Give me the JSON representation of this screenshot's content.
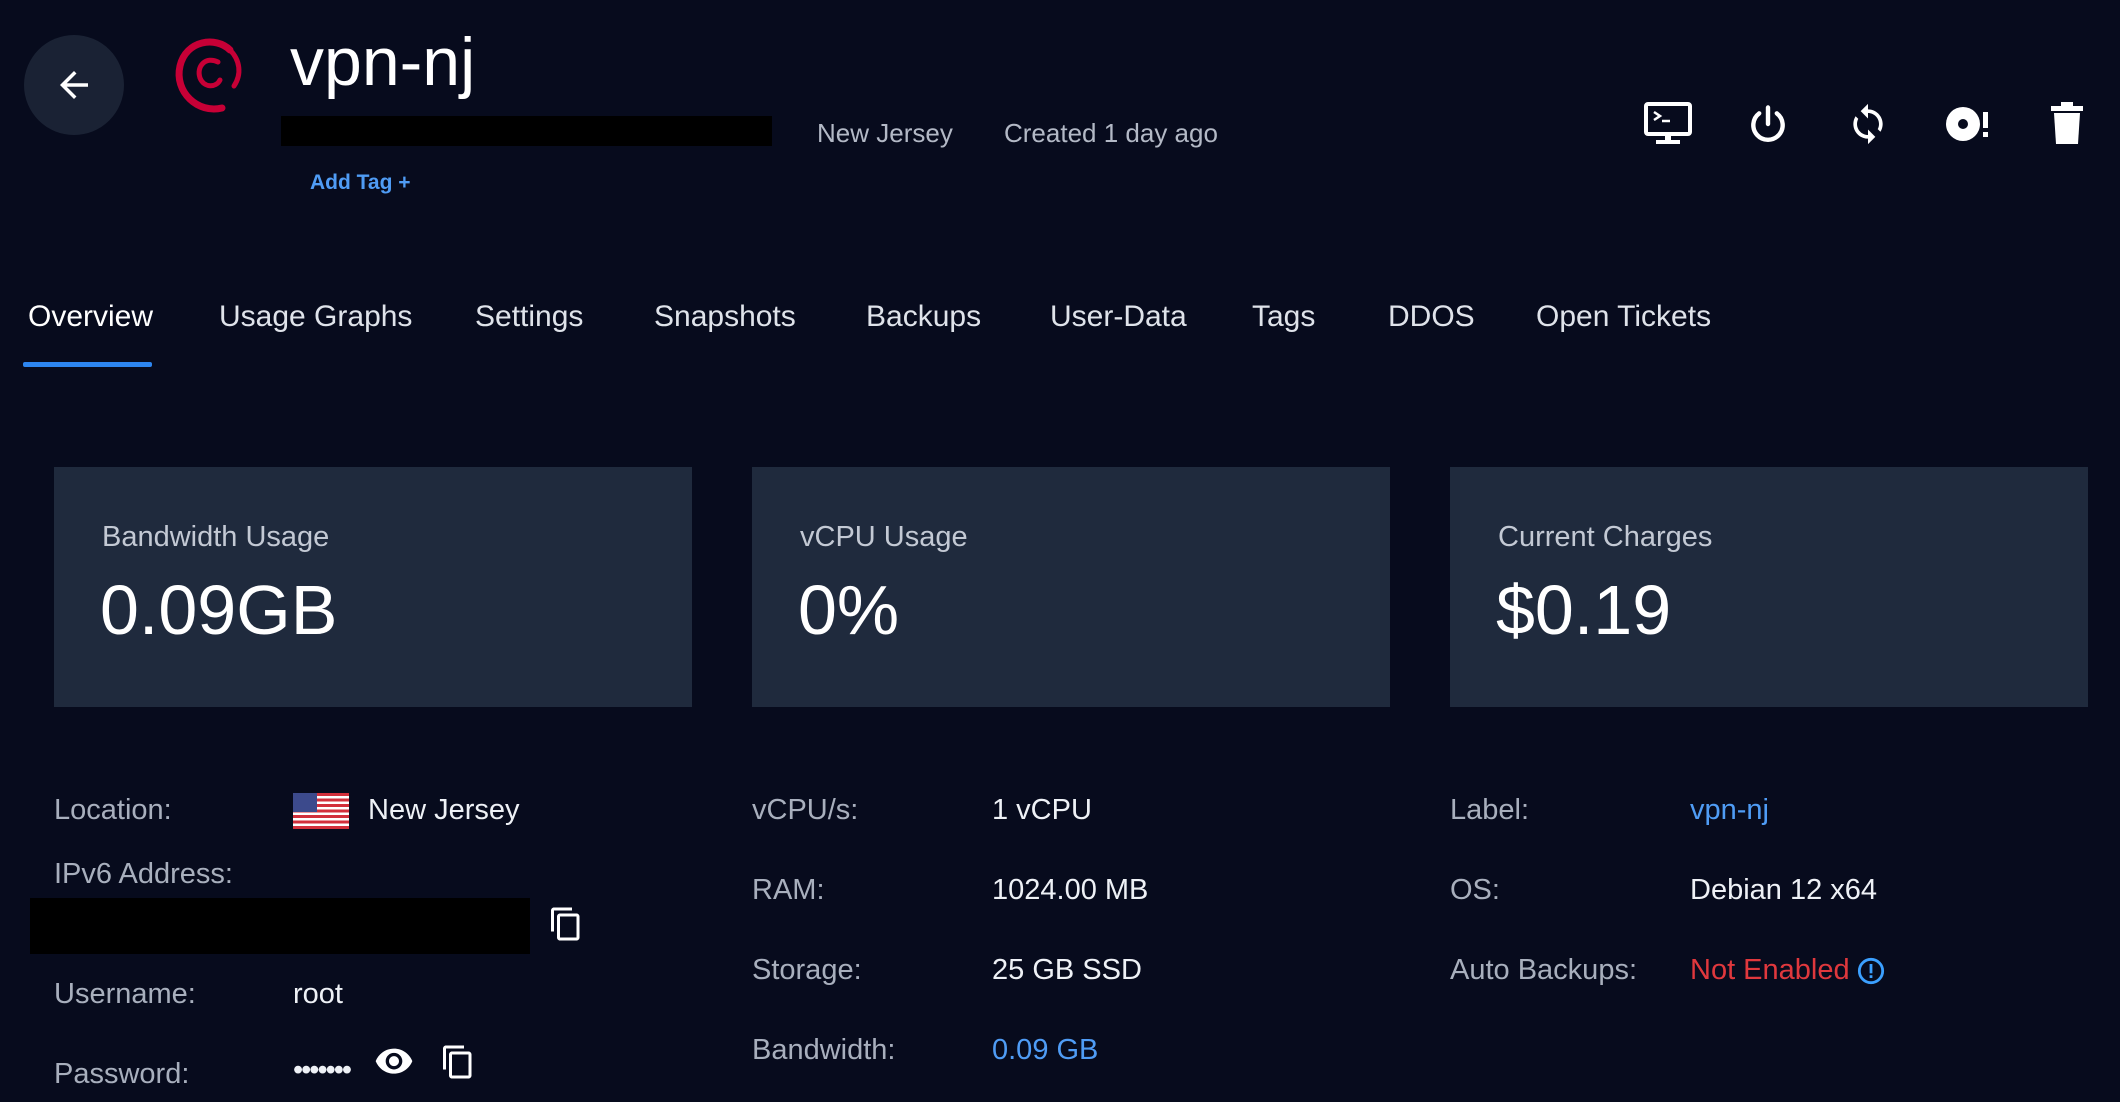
{
  "header": {
    "title": "vpn-nj",
    "location": "New Jersey",
    "created": "Created 1 day ago",
    "add_tag": "Add Tag +"
  },
  "actions": [
    "console-icon",
    "power-icon",
    "restart-icon",
    "reinstall-icon",
    "trash-icon"
  ],
  "tabs": [
    {
      "label": "Overview",
      "active": true
    },
    {
      "label": "Usage Graphs"
    },
    {
      "label": "Settings"
    },
    {
      "label": "Snapshots"
    },
    {
      "label": "Backups"
    },
    {
      "label": "User-Data"
    },
    {
      "label": "Tags"
    },
    {
      "label": "DDOS"
    },
    {
      "label": "Open Tickets"
    }
  ],
  "cards": [
    {
      "title": "Bandwidth Usage",
      "value": "0.09GB"
    },
    {
      "title": "vCPU Usage",
      "value": "0%"
    },
    {
      "title": "Current Charges",
      "value": "$0.19"
    }
  ],
  "details": {
    "location_label": "Location:",
    "location_value": "New Jersey",
    "ipv6_label": "IPv6 Address:",
    "username_label": "Username:",
    "username_value": "root",
    "password_label": "Password:",
    "password_value": "•••••••",
    "vcpu_label": "vCPU/s:",
    "vcpu_value": "1 vCPU",
    "ram_label": "RAM:",
    "ram_value": "1024.00 MB",
    "storage_label": "Storage:",
    "storage_value": "25 GB SSD",
    "bandwidth_label": "Bandwidth:",
    "bandwidth_value": "0.09 GB",
    "label_label": "Label:",
    "label_value": "vpn-nj",
    "os_label": "OS:",
    "os_value": "Debian 12 x64",
    "backups_label": "Auto Backups:",
    "backups_value": "Not Enabled"
  },
  "colors": {
    "background": "#070b1d",
    "card": "#1f2a3d",
    "accent": "#2d86f0",
    "link": "#4f9cf5",
    "danger": "#e0383d",
    "debian": "#c70036"
  }
}
